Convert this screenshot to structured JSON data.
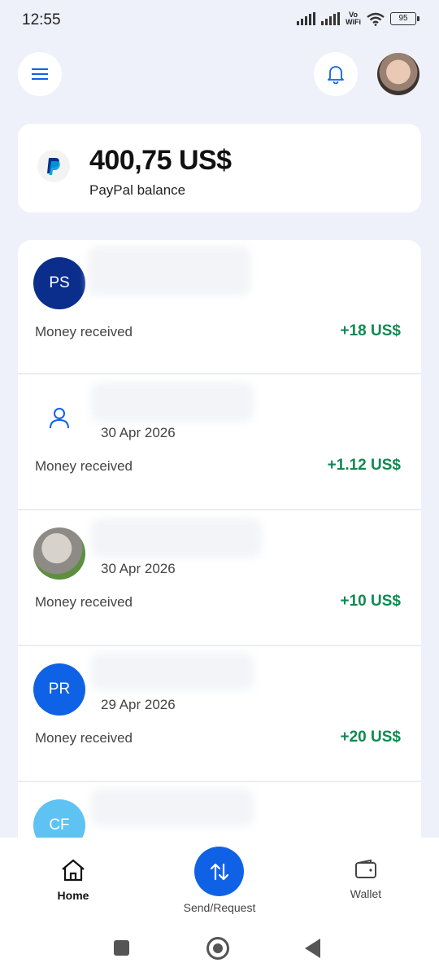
{
  "status_bar": {
    "time": "12:55",
    "network_label_top": "Vo",
    "network_label_bottom": "WiFi",
    "battery": "95"
  },
  "header": {
    "menu_icon": "hamburger-menu-icon",
    "notifications_icon": "bell-icon"
  },
  "balance": {
    "amount": "400,75 US$",
    "label": "PayPal balance"
  },
  "transactions": [
    {
      "avatar_initials": "PS",
      "avatar_color": "#0b2e8c",
      "date": "",
      "type": "Money received",
      "amount": "+18 US$"
    },
    {
      "avatar_initials": "",
      "avatar_icon": "person-icon",
      "avatar_color": "#ffffff",
      "date": "30 Apr 2026",
      "type": "Money received",
      "amount": "+1.12 US$"
    },
    {
      "avatar_initials": "",
      "avatar_color": "#b9b5b0",
      "date": "30 Apr 2026",
      "type": "Money received",
      "amount": "+10 US$"
    },
    {
      "avatar_initials": "PR",
      "avatar_color": "#0f62e6",
      "date": "29 Apr 2026",
      "type": "Money received",
      "amount": "+20 US$"
    },
    {
      "avatar_initials": "CF",
      "avatar_color": "#5ec2f2",
      "date": "",
      "type": "",
      "amount": ""
    }
  ],
  "bottom_nav": {
    "home": "Home",
    "send_request": "Send/Request",
    "wallet": "Wallet"
  },
  "colors": {
    "accent": "#0f62e6",
    "positive_amount": "#0f8a52",
    "background": "#eef1f9"
  }
}
